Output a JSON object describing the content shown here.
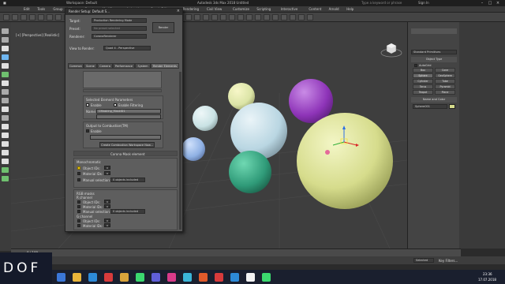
{
  "app": {
    "workspace": "Workspace: Default",
    "title": "Autodesk 3ds Max 2018    Untitled",
    "search_placeholder": "Type a keyword or phrase",
    "sign_in": "Sign In"
  },
  "menubar": [
    "Edit",
    "Tools",
    "Group",
    "Views",
    "Create",
    "Modifiers",
    "Animation",
    "Graph Editors",
    "Rendering",
    "Civil View",
    "Customize",
    "Scripting",
    "Interactive",
    "Content",
    "Arnold",
    "Help"
  ],
  "viewport": {
    "label": "[+] [Perspective] [Realistic]"
  },
  "render_setup": {
    "title": "Render Setup: Default S...",
    "target_label": "Target:",
    "target_value": "Production Rendering Mode",
    "preset_label": "Preset:",
    "preset_value": "No preset selected",
    "renderer_label": "Renderer:",
    "renderer_value": "CoronaRenderer",
    "render_button": "Render",
    "view_label": "View to Render:",
    "view_value": "Quad 4 - Perspective",
    "tabs": [
      "Common",
      "Scene",
      "Camera",
      "Performance",
      "System",
      "Render Elements"
    ],
    "selected_element_heading": "Selected Element Parameters",
    "enable_label": "Enable",
    "filtering_label": "Enable Filtering",
    "name_label": "Name:",
    "name_value": "CMasking_MaskID1",
    "output_label": "Output to Combustion(TM)",
    "output_enable_label": "Enable",
    "create_workspace_btn": "Create Combustion Workspace Now...",
    "mask_heading": "Corona Mask element",
    "mono_label": "Monochromatic",
    "object_id_label": "Object IDs:",
    "object_id_value": "0",
    "material_id_label": "Material IDs:",
    "material_id_value": "0",
    "manual_selection_label": "Manual selection:",
    "objects_included": "0 objects included",
    "rgb_heading": "RGB masks",
    "r_channel": "R channel",
    "g_channel": "G channel",
    "rgb_object_id": "Object IDs:",
    "rgb_material_id": "Material IDs:",
    "rgb_manual": "Manual selection:",
    "rgb_objects_included": "0 objects included"
  },
  "command_panel": {
    "category": "Standard Primitives",
    "object_type": "Object Type",
    "autogrid": "AutoGrid",
    "buttons": [
      "Box",
      "Cone",
      "Sphere",
      "GeoSphere",
      "Cylinder",
      "Tube",
      "Torus",
      "Pyramid",
      "Teapot",
      "Plane"
    ],
    "name_color": "Name and Color",
    "object_name": "Sphere001"
  },
  "timeline": {
    "frame": "0 / 100"
  },
  "status": {
    "selected": "Selected",
    "filters": "Key Filters...",
    "time": "23:36",
    "date": "17.07.2018"
  },
  "overlay": {
    "brand": "DOF"
  },
  "colors": {
    "sphere_yellow_green": "#d6dc8c",
    "sphere_purple": "#8e34b8",
    "sphere_teal": "#2f9a78",
    "sphere_lightblue": "#b9d6e2",
    "sphere_pale": "#dbe4a6",
    "sphere_blue": "#8fb1e4",
    "sphere_pink": "#e46a9a"
  }
}
